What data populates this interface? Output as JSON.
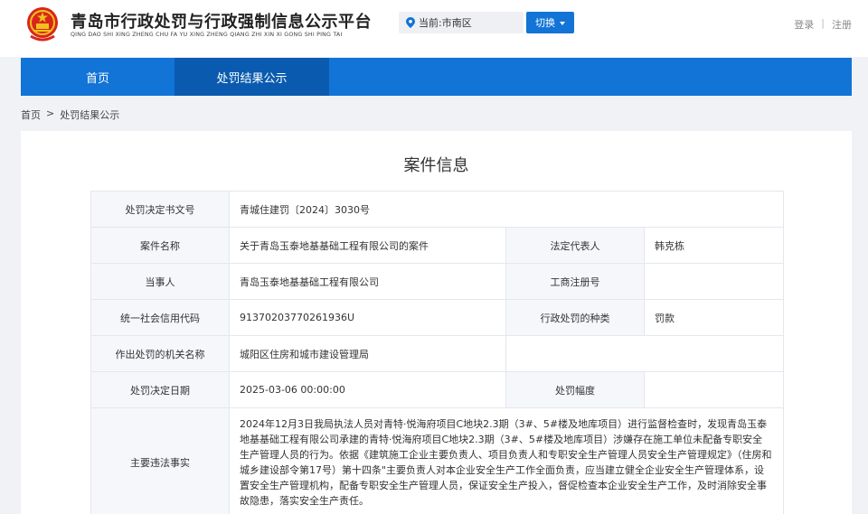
{
  "header": {
    "title": "青岛市行政处罚与行政强制信息公示平台",
    "subtitle": "QING DAO SHI XING ZHENG CHU FA YU XING ZHENG QIANG ZHI XIN XI GONG SHI PING TAI",
    "emblem_icon": "national-emblem-icon",
    "location_label": "当前:市南区",
    "switch_label": "切换",
    "login": "登录",
    "auth_separator": "|",
    "register": "注册"
  },
  "nav": {
    "items": [
      {
        "label": "首页",
        "active": false
      },
      {
        "label": "处罚结果公示",
        "active": true
      }
    ]
  },
  "breadcrumb": {
    "home": "首页",
    "separator": ">",
    "current": "处罚结果公示"
  },
  "case": {
    "title": "案件信息",
    "decision_no_label": "处罚决定书文号",
    "decision_no": "青城住建罚〔2024〕3030号",
    "case_name_label": "案件名称",
    "case_name": "关于青岛玉泰地基基础工程有限公司的案件",
    "legal_rep_label": "法定代表人",
    "legal_rep": "韩克栋",
    "party_label": "当事人",
    "party": "青岛玉泰地基基础工程有限公司",
    "reg_no_label": "工商注册号",
    "reg_no": "",
    "credit_code_label": "统一社会信用代码",
    "credit_code": "91370203770261936U",
    "penalty_type_label": "行政处罚的种类",
    "penalty_type": "罚款",
    "authority_label": "作出处罚的机关名称",
    "authority": "城阳区住房和城市建设管理局",
    "decision_date_label": "处罚决定日期",
    "decision_date": "2025-03-06 00:00:00",
    "penalty_amount_label": "处罚幅度",
    "penalty_amount": "",
    "facts_label": "主要违法事实",
    "facts": "2024年12月3日我局执法人员对青特·悦海府项目C地块2.3期（3#、5#楼及地库项目）进行监督检查时，发现青岛玉泰地基基础工程有限公司承建的青特·悦海府项目C地块2.3期（3#、5#楼及地库项目）涉嫌存在施工单位未配备专职安全生产管理人员的行为。依据《建筑施工企业主要负责人、项目负责人和专职安全生产管理人员安全生产管理规定》（住房和城乡建设部令第17号）第十四条\"主要负责人对本企业安全生产工作全面负责，应当建立健全企业安全生产管理体系，设置安全生产管理机构，配备专职安全生产管理人员，保证安全生产投入，督促检查本企业安全生产工作，及时消除安全事故隐患，落实安全生产责任。"
  }
}
